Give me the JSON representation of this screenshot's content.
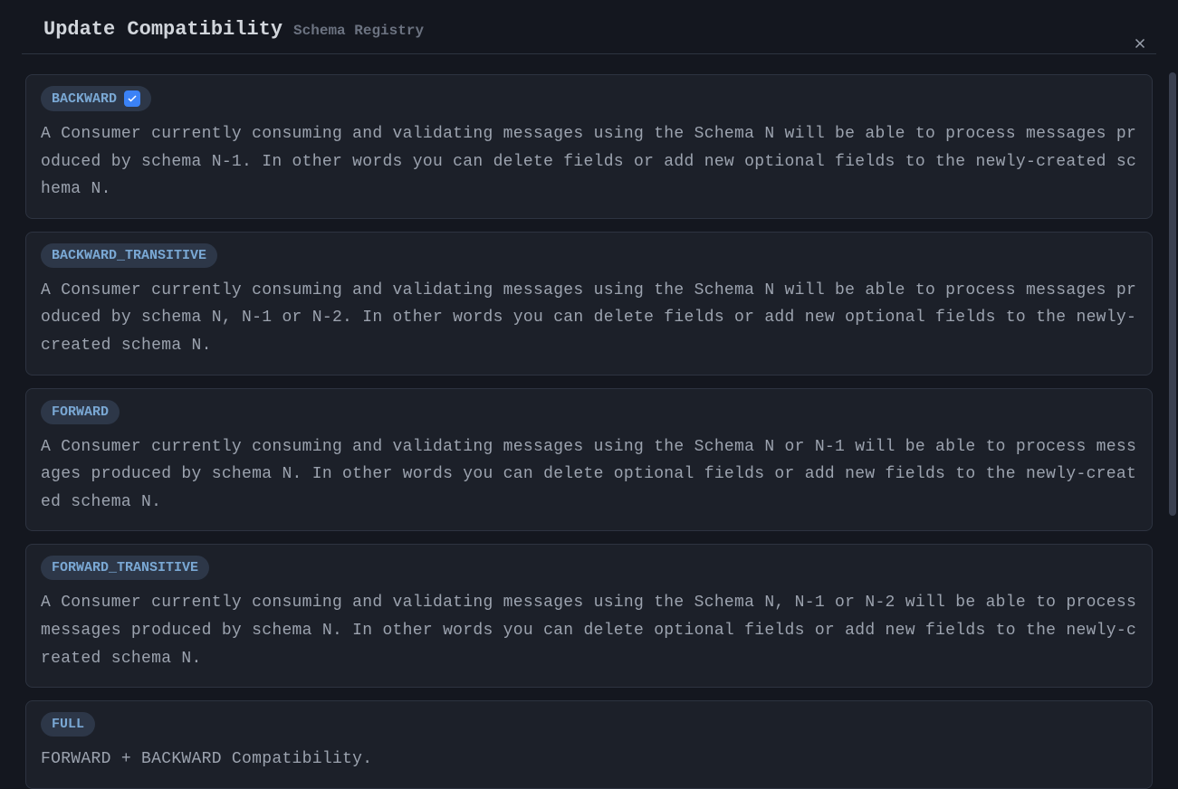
{
  "header": {
    "title": "Update Compatibility",
    "subtitle": "Schema Registry"
  },
  "options": [
    {
      "label": "BACKWARD",
      "selected": true,
      "description": "A Consumer currently consuming and validating messages using the Schema N will be able to process messages produced by schema N-1. In other words you can delete fields or add new optional fields to the newly-created schema N."
    },
    {
      "label": "BACKWARD_TRANSITIVE",
      "selected": false,
      "description": "A Consumer currently consuming and validating messages using the Schema N will be able to process messages produced by schema N, N-1 or N-2. In other words you can delete fields or add new optional fields to the newly-created schema N."
    },
    {
      "label": "FORWARD",
      "selected": false,
      "description": "A Consumer currently consuming and validating messages using the Schema N or N-1 will be able to process messages produced by schema N. In other words you can delete optional fields or add new fields to the newly-created schema N."
    },
    {
      "label": "FORWARD_TRANSITIVE",
      "selected": false,
      "description": "A Consumer currently consuming and validating messages using the Schema N, N-1 or N-2 will be able to process messages produced by schema N. In other words you can delete optional fields or add new fields to the newly-created schema N."
    },
    {
      "label": "FULL",
      "selected": false,
      "description": "FORWARD + BACKWARD Compatibility."
    }
  ]
}
